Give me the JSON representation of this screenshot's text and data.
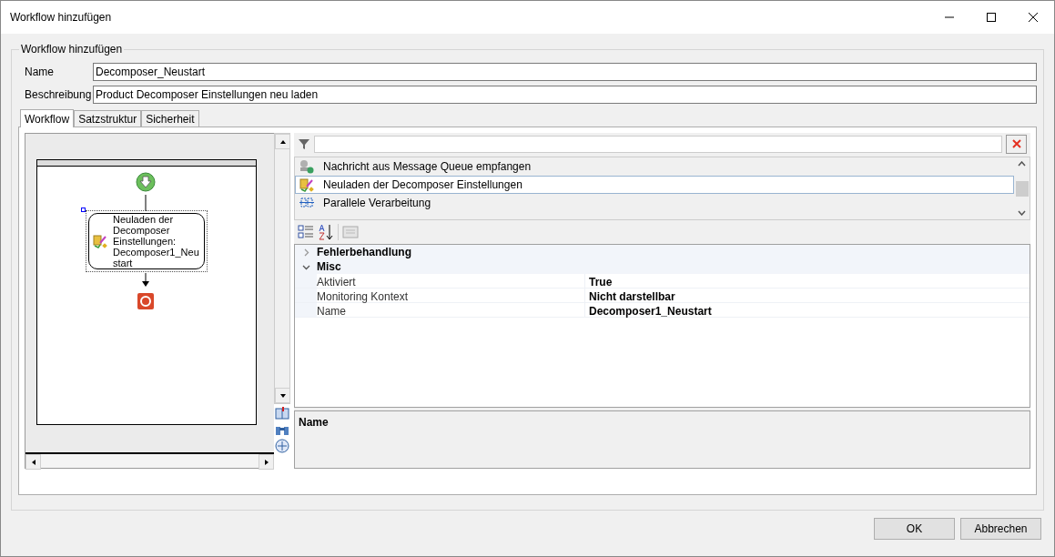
{
  "window": {
    "title": "Workflow hinzufügen"
  },
  "group_title": "Workflow hinzufügen",
  "fields": [
    {
      "label": "Name",
      "value": "Decomposer_Neustart"
    },
    {
      "label": "Beschreibung",
      "value": "Product Decomposer Einstellungen neu laden"
    }
  ],
  "tabs": [
    {
      "label": "Workflow",
      "selected": true
    },
    {
      "label": "Satzstruktur",
      "selected": false
    },
    {
      "label": "Sicherheit",
      "selected": false
    }
  ],
  "designer": {
    "activity_label": "Neuladen der Decomposer Einstellungen: Decomposer1_Neustart"
  },
  "activity_list": [
    {
      "label": "Nachricht aus Message Queue empfangen",
      "kind": "queue",
      "selected": false
    },
    {
      "label": "Neuladen der Decomposer Einstellungen",
      "kind": "reload",
      "selected": true
    },
    {
      "label": "Parallele Verarbeitung",
      "kind": "parallel",
      "selected": false
    }
  ],
  "properties": [
    {
      "category": "Fehlerbehandlung",
      "expanded": false
    },
    {
      "category": "Misc",
      "expanded": true,
      "rows": [
        {
          "name": "Aktiviert",
          "value": "True"
        },
        {
          "name": "Monitoring Kontext",
          "value": "Nicht darstellbar"
        },
        {
          "name": "Name",
          "value": "Decomposer1_Neustart"
        }
      ]
    }
  ],
  "description_title": "Name",
  "buttons": [
    "OK",
    "Abbrechen"
  ]
}
